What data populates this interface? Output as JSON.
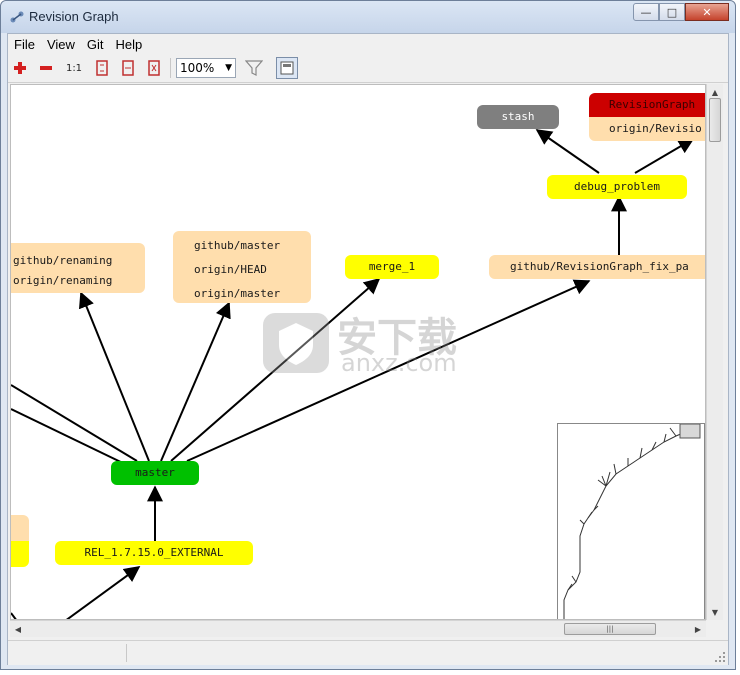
{
  "window": {
    "title": "Revision Graph",
    "controls": {
      "minimize": "—",
      "maximize": "□",
      "close": "✕"
    }
  },
  "menu": [
    {
      "label": "File"
    },
    {
      "label": "View"
    },
    {
      "label": "Git"
    },
    {
      "label": "Help"
    }
  ],
  "toolbar": {
    "zoom_in_icon": "zoom-in-icon",
    "zoom_out_icon": "zoom-out-icon",
    "actual_size_label": "1:1",
    "zoom_value": "100%",
    "filter_icon": "filter-icon",
    "overview_icon": "overview-icon"
  },
  "graph": {
    "nodes": {
      "stash": {
        "label": "stash",
        "color": "#7f7f7f"
      },
      "revisiongraph_tag": {
        "label": "RevisionGraph",
        "color": "#cc0000"
      },
      "origin_revisiongraph": {
        "label": "origin/Revisio",
        "color": "#ffdead"
      },
      "debug_problem": {
        "label": "debug_problem",
        "color": "#ffff00"
      },
      "renaming_a": {
        "label": "github/renaming",
        "color": "#ffdead"
      },
      "renaming_b": {
        "label": "origin/renaming",
        "color": "#ffdead"
      },
      "master_group_a": {
        "label": "github/master",
        "color": "#ffdead"
      },
      "master_group_b": {
        "label": "origin/HEAD",
        "color": "#ffdead"
      },
      "master_group_c": {
        "label": "origin/master",
        "color": "#ffdead"
      },
      "merge_1": {
        "label": "merge_1",
        "color": "#ffff00"
      },
      "fix_branch": {
        "label": "github/RevisionGraph_fix_pa",
        "color": "#ffdead"
      },
      "master": {
        "label": "master",
        "color": "#00c000"
      },
      "rel_tag": {
        "label": "REL_1.7.15.0_EXTERNAL",
        "color": "#ffff00"
      }
    }
  },
  "watermark": {
    "brand": "安下载",
    "domain": "anxz.com"
  },
  "scroll": {
    "h_grip": "|||"
  }
}
